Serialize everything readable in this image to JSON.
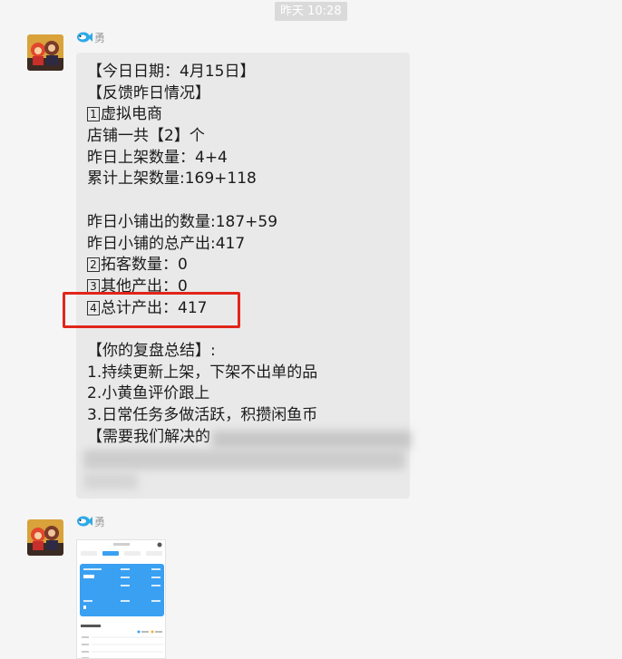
{
  "timestamp": "昨天 10:28",
  "messages": [
    {
      "sender": "勇",
      "lines": [
        {
          "text": "【今日日期：4月15日】"
        },
        {
          "text": "【反馈昨日情况】"
        },
        {
          "num": "1",
          "text": "虚拟电商"
        },
        {
          "text": "店铺一共【2】个"
        },
        {
          "text": "昨日上架数量：4+4"
        },
        {
          "text": "累计上架数量:169+118"
        },
        {
          "text": ""
        },
        {
          "text": "昨日小铺出的数量:187+59"
        },
        {
          "text": "昨日小铺的总产出:417"
        },
        {
          "num": "2",
          "text": "拓客数量：0"
        },
        {
          "num": "3",
          "text": "其他产出：0"
        },
        {
          "num": "4",
          "text": "总计产出：417"
        },
        {
          "text": ""
        },
        {
          "text": "【你的复盘总结】:"
        },
        {
          "text": "1.持续更新上架，下架不出单的品"
        },
        {
          "text": "2.小黄鱼评价跟上"
        },
        {
          "text": "3.日常任务多做活跃，积攒闲鱼币"
        },
        {
          "text": "【需要我们解决的"
        }
      ]
    },
    {
      "sender": "勇"
    }
  ],
  "colors": {
    "background": "#f5f5f5",
    "bubble": "#e9e9e9",
    "highlight": "#e1251b",
    "attachment_accent": "#3aa0f2"
  }
}
